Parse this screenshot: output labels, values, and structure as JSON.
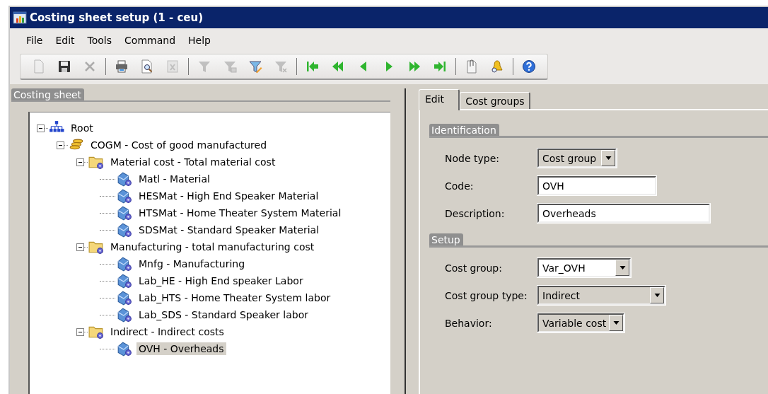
{
  "window": {
    "title": "Costing sheet setup (1 - ceu)"
  },
  "menu": [
    {
      "label": "File"
    },
    {
      "label": "Edit"
    },
    {
      "label": "Tools"
    },
    {
      "label": "Command"
    },
    {
      "label": "Help"
    }
  ],
  "toolbar": [
    {
      "kind": "new",
      "disabled": true
    },
    {
      "kind": "save",
      "disabled": false
    },
    {
      "kind": "delete",
      "disabled": true
    },
    {
      "kind": "separator"
    },
    {
      "kind": "print",
      "disabled": false
    },
    {
      "kind": "preview",
      "disabled": false
    },
    {
      "kind": "export",
      "disabled": true
    },
    {
      "kind": "separator"
    },
    {
      "kind": "filter-selection",
      "disabled": true
    },
    {
      "kind": "filter-grid",
      "disabled": true
    },
    {
      "kind": "filter-advanced",
      "disabled": false
    },
    {
      "kind": "filter-remove",
      "disabled": true
    },
    {
      "kind": "separator"
    },
    {
      "kind": "first",
      "disabled": false
    },
    {
      "kind": "prev-page",
      "disabled": false
    },
    {
      "kind": "prev",
      "disabled": false
    },
    {
      "kind": "next",
      "disabled": false
    },
    {
      "kind": "next-page",
      "disabled": false
    },
    {
      "kind": "last",
      "disabled": false
    },
    {
      "kind": "separator"
    },
    {
      "kind": "attach",
      "disabled": false
    },
    {
      "kind": "alert",
      "disabled": false
    },
    {
      "kind": "separator"
    },
    {
      "kind": "help",
      "disabled": false
    }
  ],
  "tree_panel": {
    "title": "Costing sheet",
    "tree": [
      {
        "label": "Root",
        "kind": "root",
        "expanded": true,
        "selected": false,
        "children": [
          {
            "label": "COGM - Cost of good manufactured",
            "kind": "coins",
            "expanded": true,
            "selected": false,
            "children": [
              {
                "label": "Material cost - Total material cost",
                "kind": "folder",
                "expanded": true,
                "selected": false,
                "children": [
                  {
                    "label": "Matl - Material",
                    "kind": "cost",
                    "selected": false
                  },
                  {
                    "label": "HESMat - High End Speaker Material",
                    "kind": "cost",
                    "selected": false
                  },
                  {
                    "label": "HTSMat - Home Theater System  Material",
                    "kind": "cost",
                    "selected": false
                  },
                  {
                    "label": "SDSMat - Standard Speaker Material",
                    "kind": "cost",
                    "selected": false
                  }
                ]
              },
              {
                "label": "Manufacturing - total manufacturing cost",
                "kind": "folder",
                "expanded": true,
                "selected": false,
                "children": [
                  {
                    "label": "Mnfg - Manufacturing",
                    "kind": "cost",
                    "selected": false
                  },
                  {
                    "label": "Lab_HE - High End speaker Labor",
                    "kind": "cost",
                    "selected": false
                  },
                  {
                    "label": "Lab_HTS - Home Theater System labor",
                    "kind": "cost",
                    "selected": false
                  },
                  {
                    "label": "Lab_SDS - Standard Speaker labor",
                    "kind": "cost",
                    "selected": false
                  }
                ]
              },
              {
                "label": "Indirect - Indirect costs",
                "kind": "folder",
                "expanded": true,
                "selected": false,
                "children": [
                  {
                    "label": "OVH - Overheads",
                    "kind": "cost",
                    "selected": true
                  }
                ]
              }
            ]
          }
        ]
      }
    ]
  },
  "tabs": [
    {
      "label": "Edit",
      "selected": true
    },
    {
      "label": "Cost groups",
      "selected": false
    }
  ],
  "groups": [
    {
      "title": "Identification",
      "fields": [
        {
          "label": "Node type:",
          "kind": "dropdown",
          "value": "Cost group"
        },
        {
          "label": "Code:",
          "kind": "text",
          "value": "OVH"
        },
        {
          "label": "Description:",
          "kind": "text",
          "value": "Overheads"
        }
      ]
    },
    {
      "title": "Setup",
      "fields": [
        {
          "label": "Cost group:",
          "kind": "combo",
          "value": "Var_OVH"
        },
        {
          "label": "Cost group type:",
          "kind": "dropdown",
          "value": "Indirect"
        },
        {
          "label": "Behavior:",
          "kind": "dropdown",
          "value": "Variable cost"
        }
      ]
    }
  ]
}
